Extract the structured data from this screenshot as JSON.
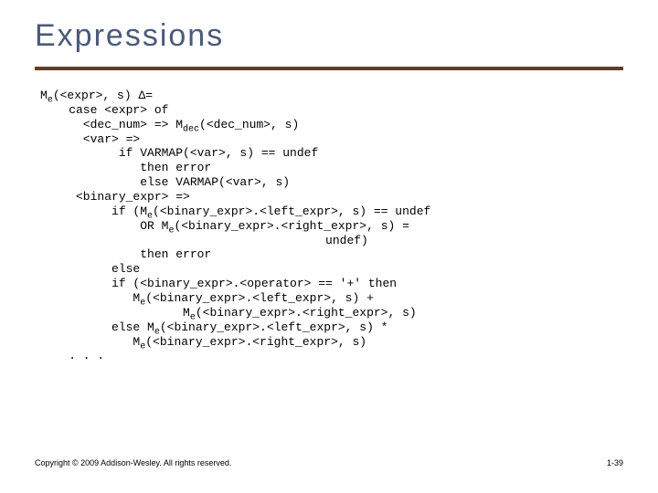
{
  "title": "Expressions",
  "code": {
    "l01a": "M",
    "l01s": "e",
    "l01b": "(<expr>, s) Δ=",
    "l02": "    case <expr> of",
    "l03a": "      <dec_num> => M",
    "l03s": "dec",
    "l03b": "(<dec_num>, s)",
    "l04": "      <var> =>",
    "l05": "           if VARMAP(<var>, s) == undef",
    "l06": "              then error",
    "l07": "              else VARMAP(<var>, s)",
    "l08": "     <binary_expr> =>",
    "l09a": "          if (M",
    "l09s": "e",
    "l09b": "(<binary_expr>.<left_expr>, s) == undef",
    "l10a": "              OR M",
    "l10s": "e",
    "l10b": "(<binary_expr>.<right_expr>, s) =",
    "l11": "                                        undef)",
    "l12": "              then error",
    "l13": "          else",
    "l14": "          if (<binary_expr>.<operator> == '+' then",
    "l15a": "             M",
    "l15s": "e",
    "l15b": "(<binary_expr>.<left_expr>, s) +",
    "l16a": "                    M",
    "l16s": "e",
    "l16b": "(<binary_expr>.<right_expr>, s)",
    "l17a": "          else M",
    "l17s": "e",
    "l17b": "(<binary_expr>.<left_expr>, s) *",
    "l18a": "             M",
    "l18s": "e",
    "l18b": "(<binary_expr>.<right_expr>, s)",
    "l19": "    . . ."
  },
  "footer": {
    "copyright": "Copyright © 2009 Addison-Wesley. All rights reserved.",
    "page": "1-39"
  }
}
